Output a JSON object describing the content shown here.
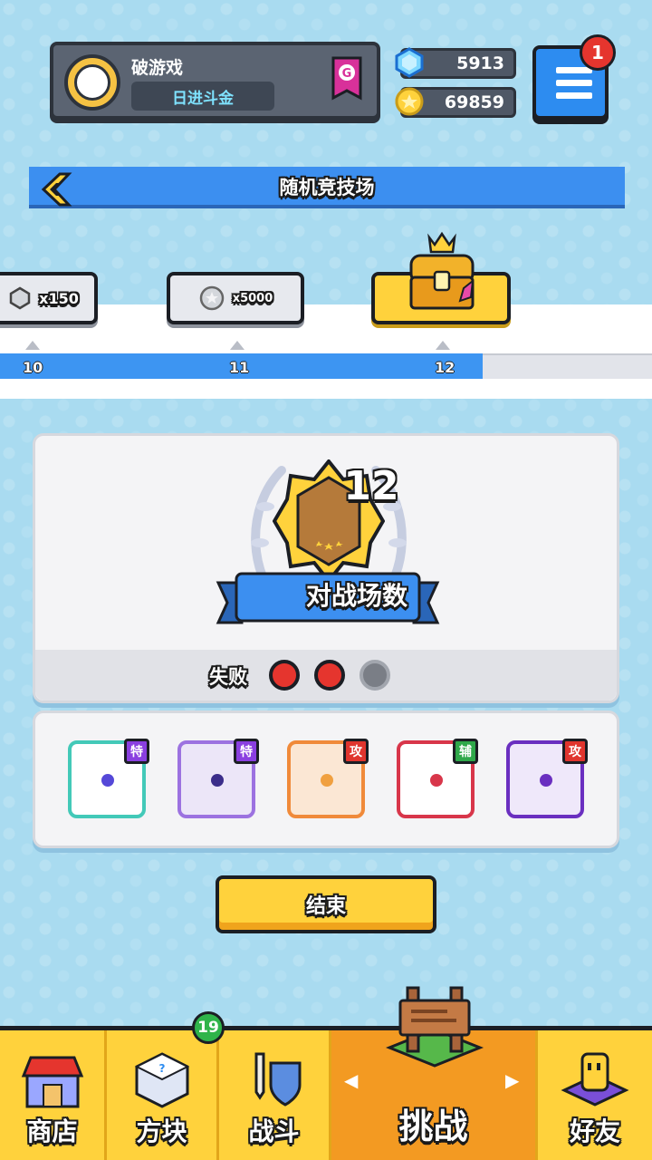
{
  "player": {
    "name": "破游戏",
    "title": "日进斗金",
    "rank_badge": "G"
  },
  "currency": {
    "gems": "5913",
    "coins": "69859"
  },
  "menu": {
    "badge_count": "1"
  },
  "header": {
    "title": "随机竞技场"
  },
  "reward_track": {
    "rewards": [
      {
        "amount": "x150",
        "icon": "gem-icon"
      },
      {
        "amount": "x5000",
        "icon": "coin-icon"
      },
      {
        "amount": "",
        "icon": "treasure-chest-icon"
      }
    ],
    "ticks": [
      "10",
      "11",
      "12"
    ],
    "progress_fraction": 0.74
  },
  "battle": {
    "count": "12",
    "ribbon_label": "对战场数",
    "loss_label": "失败",
    "losses": 2,
    "max_losses": 3
  },
  "skills": [
    {
      "tag": "特",
      "tag_color": "#8a3fe0",
      "border": "#43c9b8",
      "dot": "#5548d8",
      "icon": "hands-orb-icon"
    },
    {
      "tag": "特",
      "tag_color": "#8a3fe0",
      "border": "#9c72e0",
      "dot": "#3b2d8a",
      "icon": "shatter-orb-icon"
    },
    {
      "tag": "攻",
      "tag_color": "#e0352e",
      "border": "#f08a3a",
      "dot": "#f0a040",
      "icon": "target-orb-icon"
    },
    {
      "tag": "辅",
      "tag_color": "#2fa84a",
      "border": "#d8364a",
      "dot": "#d8364a",
      "icon": "sparkle-orb-icon"
    },
    {
      "tag": "攻",
      "tag_color": "#e0352e",
      "border": "#6a2fc0",
      "dot": "#6a2fc0",
      "icon": "dragon-orb-icon"
    }
  ],
  "end_button": {
    "label": "结束"
  },
  "nav": {
    "shop": "商店",
    "cubes": "方块",
    "cubes_badge": "19",
    "battle": "战斗",
    "challenge": "挑战",
    "friends": "好友"
  },
  "colors": {
    "accent_blue": "#3c8ff0",
    "accent_yellow": "#ffd23c",
    "nav_active": "#f39a22",
    "background": "#a9dbf0"
  }
}
